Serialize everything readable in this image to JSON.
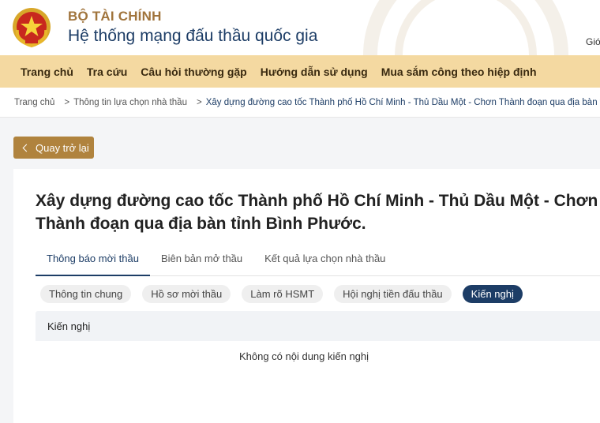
{
  "header": {
    "org_name": "BỘ TÀI CHÍNH",
    "system_name": "Hệ thống mạng đấu thầu quốc gia",
    "right_hint": "Giớ"
  },
  "nav": {
    "items": [
      "Trang chủ",
      "Tra cứu",
      "Câu hỏi thường gặp",
      "Hướng dẫn sử dụng",
      "Mua sắm công theo hiệp định"
    ]
  },
  "breadcrumb": {
    "items": [
      "Trang chủ",
      "Thông tin lựa chọn nhà thầu",
      "Xây dựng đường cao tốc Thành phố Hồ Chí Minh - Thủ Dầu Một - Chơn Thành đoạn qua địa bàn tỉnh Bìn"
    ],
    "separator": ">"
  },
  "back_button": {
    "label": "Quay trở lại"
  },
  "page": {
    "title": "Xây dựng đường cao tốc Thành phố Hồ Chí Minh - Thủ Dầu Một - Chơn Thành đoạn qua địa bàn tỉnh Bình Phước."
  },
  "tabs": {
    "items": [
      "Thông báo mời thầu",
      "Biên bản mở thầu",
      "Kết quả lựa chọn nhà thầu"
    ],
    "active": "Thông báo mời thầu"
  },
  "subtabs": {
    "items": [
      "Thông tin chung",
      "Hồ sơ mời thầu",
      "Làm rõ HSMT",
      "Hội nghị tiền đấu thầu",
      "Kiến nghị"
    ],
    "active": "Kiến nghị"
  },
  "table": {
    "header": "Kiến nghị",
    "empty_message": "Không có nội dung kiến nghị"
  },
  "colors": {
    "brand_gold": "#a0743c",
    "nav_bg": "#f4d9a1",
    "primary_navy": "#1d3d66",
    "back_button": "#b0833e"
  }
}
